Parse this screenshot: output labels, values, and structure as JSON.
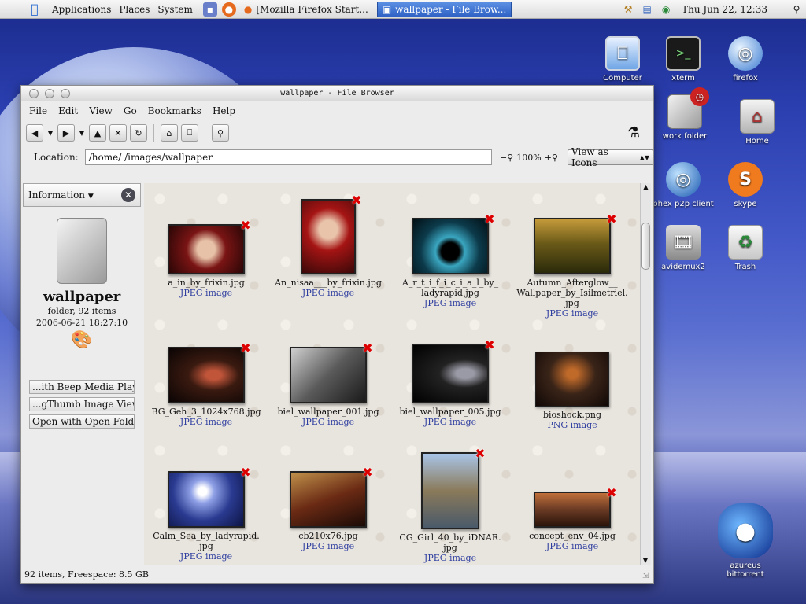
{
  "panel": {
    "menus": [
      "Applications",
      "Places",
      "System"
    ],
    "tasks": [
      {
        "label": "[Mozilla Firefox Start..."
      },
      {
        "label": "wallpaper - File Brow..."
      }
    ],
    "clock": "Thu Jun 22, 12:33",
    "icons": [
      "apple-icon",
      "terminal-launcher-icon",
      "firefox-launcher-icon",
      "tray-tool-icon",
      "tray-network-icon",
      "tray-volume-icon",
      "search-icon"
    ]
  },
  "desktop": {
    "icons": [
      {
        "label": "Computer",
        "icon": "computer-icon"
      },
      {
        "label": "xterm",
        "icon": "terminal-icon"
      },
      {
        "label": "firefox",
        "icon": "globe-icon"
      },
      {
        "label": "work folder",
        "icon": "folder-icon"
      },
      {
        "label": "Home",
        "icon": "home-icon"
      },
      {
        "label": "phex p2p client",
        "icon": "globe-icon"
      },
      {
        "label": "skype",
        "icon": "skype-icon"
      },
      {
        "label": "avidemux2",
        "icon": "film-icon"
      },
      {
        "label": "Trash",
        "icon": "trash-icon"
      },
      {
        "label": "azureus bittorrent",
        "icon": "frog-icon"
      }
    ]
  },
  "window": {
    "title": "wallpaper - File Browser",
    "menus": [
      "File",
      "Edit",
      "View",
      "Go",
      "Bookmarks",
      "Help"
    ],
    "location_label": "Location:",
    "location_value": "/home/       /images/wallpaper",
    "zoom": "100%",
    "view_as": "View as Icons",
    "status": "92 items, Freespace: 8.5 GB"
  },
  "sidebar": {
    "header": "Information",
    "name": "wallpaper",
    "info1": "folder, 92 items",
    "info2": "2006-06-21 18:27:10",
    "open_with": [
      "...ith Beep Media Player",
      "...gThumb Image Viewer",
      "Open with Open Folder"
    ]
  },
  "files": [
    {
      "name": "a_in_by_frixin.jpg",
      "type": "JPEG image",
      "color": "#7a1414"
    },
    {
      "name": "An_nisaa___by_frixin.jpg",
      "type": "JPEG image",
      "color": "#8a1010"
    },
    {
      "name": "A_r_t_i_f_i_c_i_a_l_by_ ladyrapid.jpg",
      "type": "JPEG image",
      "color": "#0c3a4a"
    },
    {
      "name": "Autumn_Afterglow__ Wallpaper_by_Isilmetriel. jpg",
      "type": "JPEG image",
      "color": "#5a4a14"
    },
    {
      "name": "BG_Geh_3_1024x768.jpg",
      "type": "JPEG image",
      "color": "#3a1a10"
    },
    {
      "name": "biel_wallpaper_001.jpg",
      "type": "JPEG image",
      "color": "#5a5a5a"
    },
    {
      "name": "biel_wallpaper_005.jpg",
      "type": "JPEG image",
      "color": "#111111"
    },
    {
      "name": "bioshock.png",
      "type": "PNG image",
      "color": "#3a2418"
    },
    {
      "name": "Calm_Sea_by_ladyrapid. jpg",
      "type": "JPEG image",
      "color": "#2a3a90"
    },
    {
      "name": "cb210x76.jpg",
      "type": "JPEG image",
      "color": "#6a2a14"
    },
    {
      "name": "CG_Girl_40_by_iDNAR. jpg",
      "type": "JPEG image",
      "color": "#8a7a5a"
    },
    {
      "name": "concept_env_04.jpg",
      "type": "JPEG image",
      "color": "#6a3a24"
    }
  ]
}
